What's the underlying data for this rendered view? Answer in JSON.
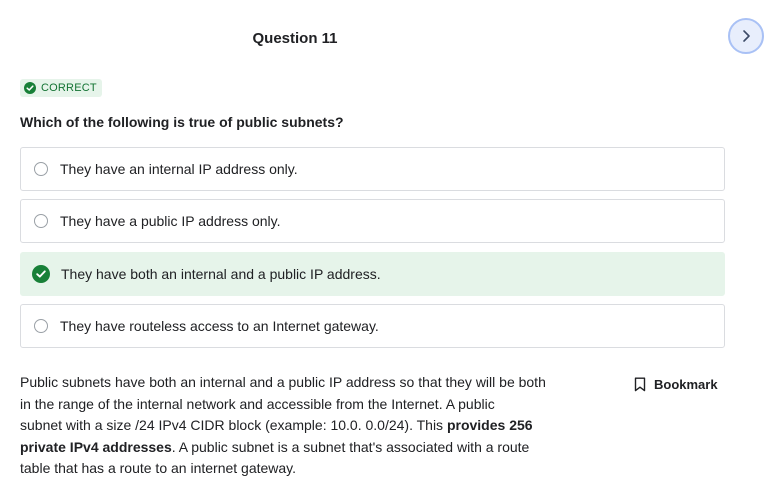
{
  "header": {
    "question_title": "Question 11"
  },
  "nav": {
    "next_icon": "chevron-right-icon"
  },
  "status": {
    "badge_label": "CORRECT",
    "badge_icon": "check-circle-icon",
    "color": "#188038"
  },
  "question": {
    "prompt": "Which of the following is true of public subnets?"
  },
  "options": [
    {
      "label": "They have an internal IP address only.",
      "selected": false,
      "correct": false
    },
    {
      "label": "They have a public IP address only.",
      "selected": false,
      "correct": false
    },
    {
      "label": "They have both an internal and a public IP address.",
      "selected": true,
      "correct": true
    },
    {
      "label": "They have routeless access to an Internet gateway.",
      "selected": false,
      "correct": false
    }
  ],
  "explanation": {
    "line1": "Public subnets have both an internal and a public IP address so that they will be both",
    "line2": "in the range of the internal network and accessible from the Internet. A public",
    "line3_a": "subnet with a size /24 IPv4 CIDR block (example: 10.0. 0.0/24). This ",
    "line3_bold": "provides 256",
    "line4_bold": "private IPv4 addresses",
    "line4_b": ". A public subnet is a subnet that's associated with a route",
    "line5": "table that has a route to an internet gateway."
  },
  "bookmark": {
    "label": "Bookmark",
    "icon": "bookmark-icon"
  },
  "colors": {
    "accent": "#188038",
    "correct_bg": "#e6f4ea",
    "nav_bg": "#e8eefc"
  }
}
